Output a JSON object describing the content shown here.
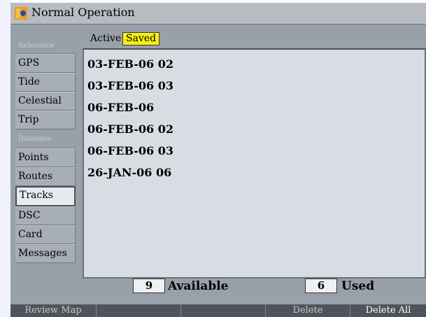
{
  "window": {
    "title": "Normal Operation",
    "icon": "garmin-app-icon"
  },
  "sidebar": {
    "groups": [
      {
        "label": "Reference",
        "items": [
          "GPS",
          "Tide",
          "Celestial",
          "Trip"
        ]
      },
      {
        "label": "Database",
        "items": [
          "Points",
          "Routes",
          "Tracks",
          "DSC",
          "Card",
          "Messages"
        ]
      }
    ],
    "selected": "Tracks"
  },
  "tabs": {
    "active_label": "Active",
    "saved_label": "Saved",
    "selected": "Saved"
  },
  "saved_tracks": [
    "03-FEB-06 02",
    "03-FEB-06 03",
    "06-FEB-06",
    "06-FEB-06 02",
    "06-FEB-06 03",
    "26-JAN-06 06"
  ],
  "counts": {
    "available_value": "9",
    "available_label": "Available",
    "used_value": "6",
    "used_label": "Used"
  },
  "softkeys": [
    {
      "label": "Review Map",
      "enabled": false
    },
    {
      "label": "",
      "enabled": false
    },
    {
      "label": "",
      "enabled": false
    },
    {
      "label": "Delete",
      "enabled": false
    },
    {
      "label": "Delete All",
      "enabled": true
    }
  ],
  "colors": {
    "highlight": "#f7ef10",
    "panel": "#d7dde3",
    "frame": "#98a0aa",
    "footer": "#4e545c"
  }
}
